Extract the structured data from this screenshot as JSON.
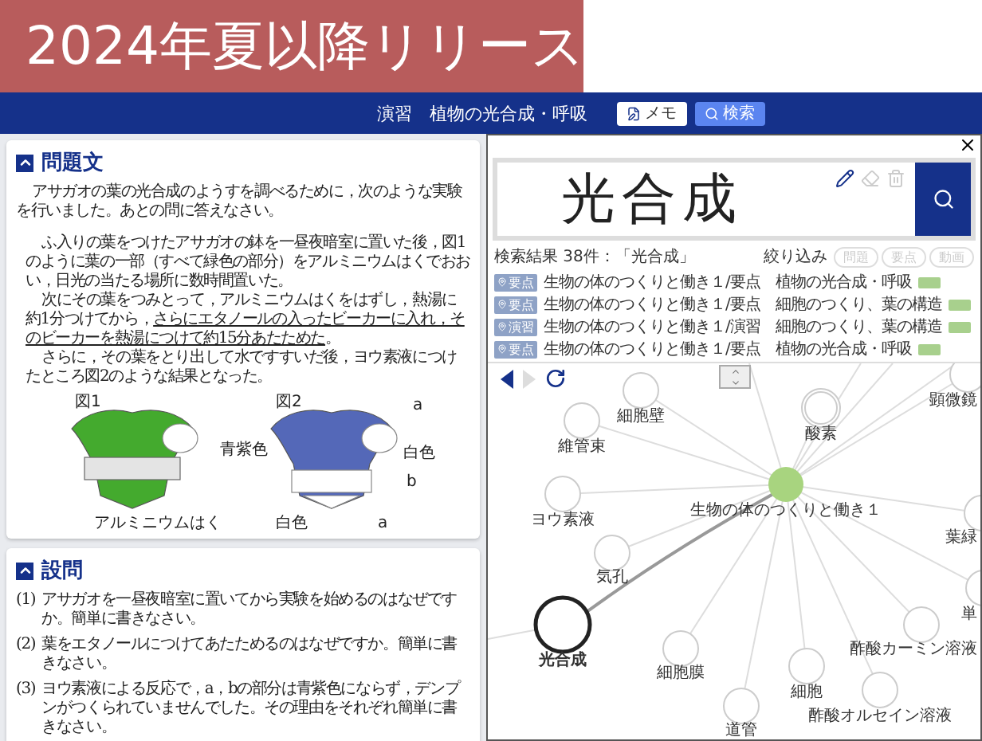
{
  "release_banner": "2024年夏以降リリース",
  "header": {
    "title": "演習　植物の光合成・呼吸",
    "buttons": [
      {
        "label": "メモ",
        "kind": "memo",
        "selected": false
      },
      {
        "label": "検索",
        "kind": "search",
        "selected": true
      }
    ]
  },
  "problem": {
    "title": "問題文",
    "expanded": true,
    "paragraphs": [
      {
        "kind": "lead",
        "parts": [
          {
            "text": "アサガオの葉の光合成のようすを調べるために，次のような実験を行いました。あとの問に答えなさい。",
            "underline": false
          }
        ]
      },
      {
        "kind": "body",
        "parts": [
          {
            "text": "ふ入りの葉をつけたアサガオの鉢を一昼夜暗室に置いた後，図1のように葉の一部（すべて緑色の部分）をアルミニウムはくでおおい，日光の当たる場所に数時間置いた。",
            "underline": false
          }
        ]
      },
      {
        "kind": "body",
        "parts": [
          {
            "text": "次にその葉をつみとって，アルミニウムはくをはずし，熱湯に約1分つけてから，",
            "underline": false
          },
          {
            "text": "さらにエタノールの入ったビーカーに入れ，そのビーカーを熱湯につけて約15分あたためた",
            "underline": true
          },
          {
            "text": "。",
            "underline": false
          }
        ]
      },
      {
        "kind": "body",
        "parts": [
          {
            "text": "さらに，その葉をとり出して水ですすいだ後，ヨウ素液につけたところ図2のような結果となった。",
            "underline": false
          }
        ]
      }
    ],
    "figures": [
      {
        "caption": "図1",
        "labels": [
          "アルミニウムはく"
        ]
      },
      {
        "caption": "図2",
        "labels": [
          "a",
          "白色",
          "青紫色",
          "b",
          "白色",
          "a"
        ]
      }
    ]
  },
  "questions": {
    "title": "設問",
    "expanded": true,
    "items": [
      {
        "number": "(1)",
        "text": "アサガオを一昼夜暗室に置いてから実験を始めるのはなぜですか。簡単に書きなさい。"
      },
      {
        "number": "(2)",
        "text": "葉をエタノールにつけてあたためるのはなぜですか。簡単に書きなさい。"
      },
      {
        "number": "(3)",
        "text": "ヨウ素液による反応で，a，bの部分は青紫色にならず，デンプンがつくられていませんでした。その理由をそれぞれ簡単に書きなさい。"
      }
    ]
  },
  "search_panel": {
    "handwriting": "光合成",
    "tools": [
      {
        "kind": "pen",
        "selected": true
      },
      {
        "kind": "eraser",
        "selected": false
      },
      {
        "kind": "trash",
        "selected": false
      }
    ],
    "result_summary": "検索結果 38件：「光合成」",
    "filter_label": "絞り込み",
    "filters": [
      {
        "label": "問題",
        "disabled": true
      },
      {
        "label": "要点",
        "disabled": true
      },
      {
        "label": "動画",
        "disabled": true
      }
    ],
    "results": [
      {
        "badge": "要点",
        "text": "生物の体のつくりと働き１/要点　植物の光合成・呼吸"
      },
      {
        "badge": "要点",
        "text": "生物の体のつくりと働き１/要点　細胞のつくり、葉の構造"
      },
      {
        "badge": "演習",
        "text": "生物の体のつくりと働き１/演習　細胞のつくり、葉の構造"
      },
      {
        "badge": "要点",
        "text": "生物の体のつくりと働き１/要点　植物の光合成・呼吸"
      }
    ]
  },
  "graph": {
    "back_enabled": true,
    "forward_enabled": false,
    "center": {
      "label": "生物の体のつくりと働き１"
    },
    "nodes": [
      {
        "label": "細胞壁",
        "kind": "normal"
      },
      {
        "label": "維管束",
        "kind": "normal"
      },
      {
        "label": "酸素",
        "kind": "double"
      },
      {
        "label": "顕微鏡",
        "kind": "normal"
      },
      {
        "label": "ヨウ素液",
        "kind": "normal"
      },
      {
        "label": "気孔",
        "kind": "normal"
      },
      {
        "label": "葉緑",
        "kind": "normal"
      },
      {
        "label": "単",
        "kind": "normal"
      },
      {
        "label": "光合成",
        "kind": "focus"
      },
      {
        "label": "細胞膜",
        "kind": "normal"
      },
      {
        "label": "道管",
        "kind": "normal"
      },
      {
        "label": "細胞",
        "kind": "normal"
      },
      {
        "label": "酢酸カーミン溶液",
        "kind": "normal"
      },
      {
        "label": "酢酸オルセイン溶液",
        "kind": "normal"
      }
    ]
  }
}
